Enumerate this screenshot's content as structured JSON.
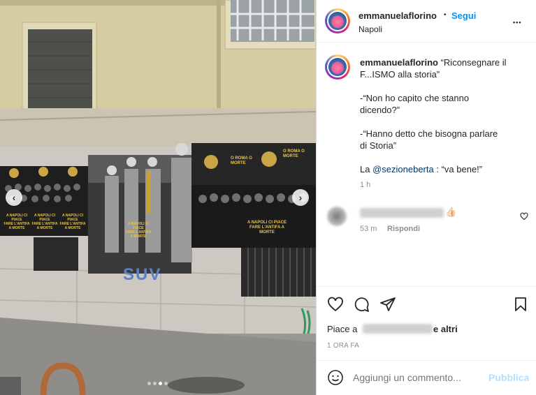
{
  "header": {
    "username": "emmanuelaflorino",
    "separator": "•",
    "follow_label": "Segui",
    "location": "Napoli",
    "more": "•••"
  },
  "caption": {
    "username": "emmanuelaflorino",
    "line1": "“Riconsegnare il",
    "line2": "F...ISMO alla storia”",
    "p2_line1": "-“Non ho capito che stanno",
    "p2_line2": "dicendo?”",
    "p3_line1": "-“Hanno detto che bisogna parlare",
    "p3_line2": "di Storia”",
    "p4_prefix": "La",
    "mention": "@sezioneberta",
    "p4_suffix": ": “va bene!”",
    "time": "1 h"
  },
  "comment": {
    "emoji": "👍🏻",
    "time": "53 m",
    "reply_label": "Rispondi"
  },
  "likes": {
    "prefix": "Piace a",
    "suffix": "e altri",
    "time": "1 ORA FA"
  },
  "add_comment": {
    "placeholder": "Aggiungi un commento...",
    "publish_label": "Pubblica"
  },
  "carousel": {
    "prev": "‹",
    "next": "›",
    "slides": 4,
    "active_slide": 3
  },
  "image": {
    "posters": [
      {
        "line1": "A NAPOLI CI PIACE",
        "line2": "FARE L'ANTIFA A MORTE"
      },
      {
        "line1": "A NAPOLI CI PIACE",
        "line2": "FARE L'ANTIFA A MORTE"
      },
      {
        "line1": "A NAPOLI CI PIACE",
        "line2": "FARE L'ANTIFA A MORTE"
      },
      {
        "line1": "A NAPOLI CI PIACE",
        "line2": "FARE L'ANTIFA A MORTE"
      },
      {
        "line1": "A NAPOLI CI PIACE",
        "line2": "FARE L'ANTIFA A MORTE"
      }
    ],
    "banner1": "O ROMA O MORTE",
    "banner2": "O ROMA O MORTE",
    "graffiti": "SUV"
  },
  "colors": {
    "accent": "#0095f6",
    "mention": "#00376b",
    "muted": "#8e8e8e",
    "publish_disabled": "#b2dffc"
  }
}
